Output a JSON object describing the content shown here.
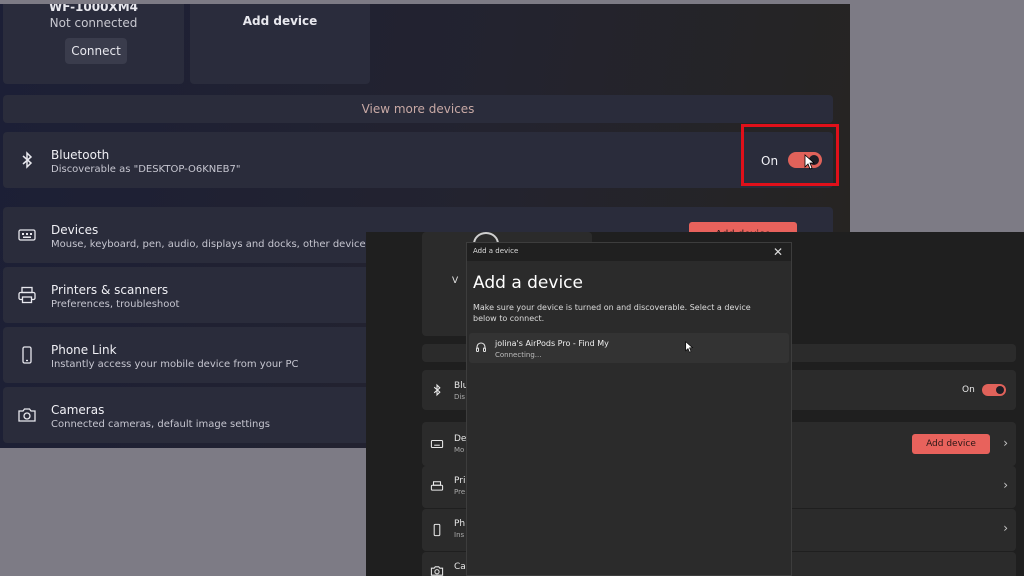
{
  "back_window": {
    "tiles": [
      {
        "name": "WF-1000XM4",
        "status": "Not connected",
        "button": "Connect"
      },
      {
        "name": "Add device"
      }
    ],
    "view_more": "View more devices",
    "bluetooth": {
      "title": "Bluetooth",
      "subtitle": "Discoverable as \"DESKTOP-O6KNEB7\"",
      "state": "On"
    },
    "rows": [
      {
        "title": "Devices",
        "subtitle": "Mouse, keyboard, pen, audio, displays and docks, other devices",
        "icon": "keyboard-icon"
      },
      {
        "title": "Printers & scanners",
        "subtitle": "Preferences, troubleshoot",
        "icon": "printer-icon"
      },
      {
        "title": "Phone Link",
        "subtitle": "Instantly access your mobile device from your PC",
        "icon": "phone-icon"
      },
      {
        "title": "Cameras",
        "subtitle": "Connected cameras, default image settings",
        "icon": "camera-icon"
      }
    ],
    "partial_button": "Add device",
    "accent": "#e0625a",
    "highlight_color": "#e0101a"
  },
  "front_window": {
    "bluetooth": {
      "title_fragment": "Blu",
      "sub_fragment": "Dis",
      "state": "On"
    },
    "rows": [
      {
        "title_fragment": "De",
        "sub_fragment": "Mo",
        "icon": "keyboard-icon"
      },
      {
        "title_fragment": "Pri",
        "sub_fragment": "Pre",
        "icon": "printer-icon"
      },
      {
        "title_fragment": "Ph",
        "sub_fragment": "Ins",
        "icon": "phone-icon"
      },
      {
        "title_fragment": "Ca",
        "sub_fragment": "",
        "icon": "camera-icon"
      }
    ],
    "add_device_button": "Add device",
    "tile_fragment": "V"
  },
  "dialog": {
    "window_title": "Add a device",
    "heading": "Add a device",
    "description": "Make sure your device is turned on and discoverable. Select a device below to connect.",
    "device": {
      "name": "jolina's AirPods Pro - Find My",
      "status": "Connecting...",
      "icon": "headphones-icon"
    },
    "close_glyph": "✕"
  }
}
